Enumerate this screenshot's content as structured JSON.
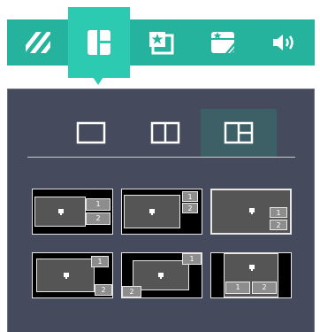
{
  "toolbar": {
    "items": [
      {
        "icon": "stripes-icon"
      },
      {
        "icon": "layout-icon",
        "active": true
      },
      {
        "icon": "star-frame-icon"
      },
      {
        "icon": "star-window-icon"
      },
      {
        "icon": "volume-icon"
      }
    ]
  },
  "layout_tabs": [
    {
      "icon": "single-view-icon"
    },
    {
      "icon": "split-view-icon"
    },
    {
      "icon": "triple-view-icon",
      "active": true
    }
  ],
  "presets": {
    "labels": {
      "one": "1",
      "two": "2"
    }
  },
  "colors": {
    "accent": "#26b39d",
    "accent_active": "#2ccab1",
    "panel": "#454a5c"
  }
}
